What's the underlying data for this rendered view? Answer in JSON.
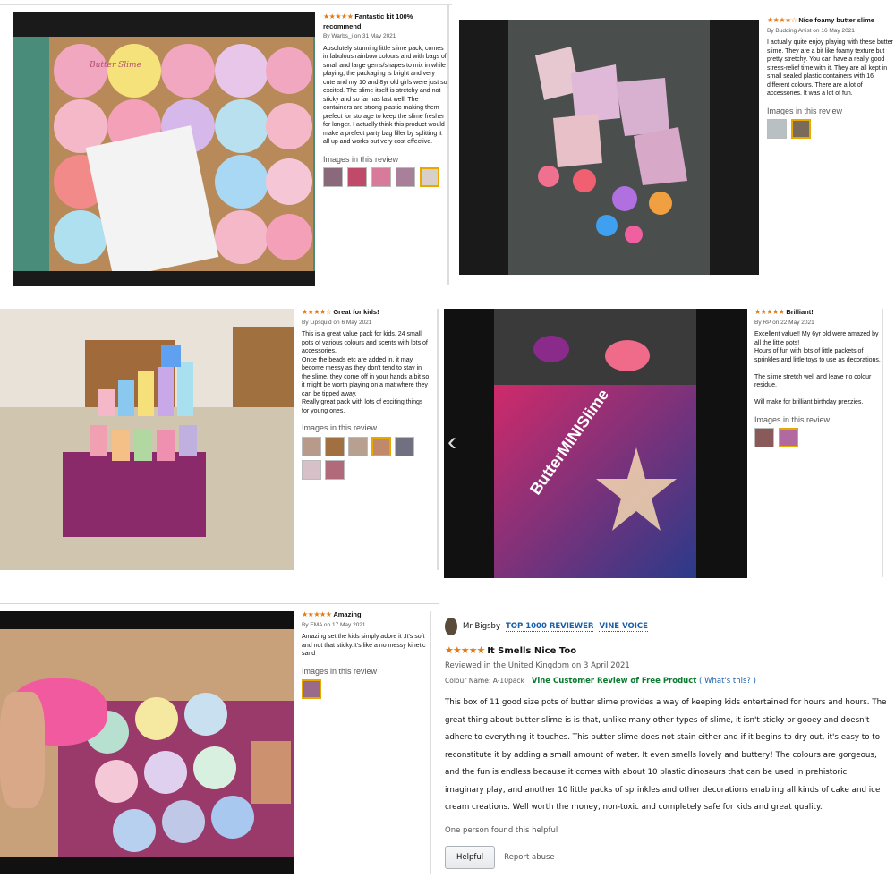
{
  "reviews": [
    {
      "stars": "★★★★★",
      "title": "Fantastic kit 100% recommend",
      "byline": "By Warbs_i on 31 May 2021",
      "body": "Absolutely stunning little slime pack, comes in fabulous rainbow colours and with bags of small and large gems/shapes to mix in while playing, the packaging is bright and very cute and my 10 and 8yr old girls were just so excited. The slime itself is stretchy and not sticky and so far has last well. The containers are strong plastic making them prefect for storage to keep the slime fresher for longer. I actually think this product would make a prefect party bag filler by splitting it all up and works out very cost effective.",
      "images_heading": "Images in this review"
    },
    {
      "stars": "★★★★☆",
      "title": "Nice foamy butter slime",
      "byline": "By Budding Artist on 16 May 2021",
      "body": "I actually quite enjoy playing with these butter slime. They are a bit like foamy texture but pretty stretchy. You can have a really good stress-relief time with it. They are all kept in small sealed plastic containers with 16 different colours. There are a lot of accessories. It was a lot of fun.",
      "images_heading": "Images in this review"
    },
    {
      "stars": "★★★★☆",
      "title": "Great for kids!",
      "byline": "By Lipsquid on 6 May 2021",
      "body": "This is a great value pack for kids. 24 small pots of various colours and scents with lots of accessories.\nOnce the beads etc are added in, it may become messy as they don't tend to stay in the slime, they come off in your hands a bit so it might be worth playing on a mat where they can be tipped away.\nReally great pack with lots of exciting things for young ones.",
      "images_heading": "Images in this review"
    },
    {
      "stars": "★★★★★",
      "title": "Brilliant!",
      "byline": "By RP on 22 May 2021",
      "body": "Excellent value!! My 6yr old were amazed by all the little pots!\nHours of fun with lots of little packets of sprinkles and little toys to use as decorations.\n\nThe slime stretch well and leave no colour residue.\n\nWill make for brilliant birthday prezzies.",
      "images_heading": "Images in this review"
    },
    {
      "stars": "★★★★★",
      "title": "Amazing",
      "byline": "By EMA on 17 May 2021",
      "body": "Amazing set,the kids simply adore it .It's soft and not that sticky.It's like a no messy kinetic sand",
      "images_heading": "Images in this review"
    }
  ],
  "photo_labels": {
    "box_brand": "ButterMINISlime",
    "pot_label": "Butter Slime"
  },
  "featured": {
    "reviewer": "Mr Bigsby",
    "badge1": "TOP 1000 REVIEWER",
    "badge2": "VINE VOICE",
    "stars": "★★★★★",
    "title": "It Smells Nice Too",
    "reviewed_in": "Reviewed in the United Kingdom on 3 April 2021",
    "colour": "Colour Name: A-10pack",
    "vine": "Vine Customer Review of Free Product",
    "whats_this": "( What's this? )",
    "text": "This box of 11 good size pots of butter slime provides a way of keeping kids entertained for hours and hours. The great thing about butter slime is is that, unlike many other types of slime, it isn't sticky or gooey and doesn't adhere to everything it touches. This butter slime does not stain either and if it begins to dry out, it's easy to to reconstitute it by adding a small amount of water. It even smells lovely and buttery! The colours are gorgeous, and the fun is endless because it comes with about 10 plastic dinosaurs that can be used in prehistoric imaginary play, and another 10 little packs of sprinkles and other decorations enabling all kinds of cake and ice cream creations. Well worth the money, non-toxic and completely safe for kids and great quality.",
    "found_helpful": "One person found this helpful",
    "helpful_button": "Helpful",
    "report": "Report abuse"
  },
  "colors": {
    "star": "#e47911",
    "link": "#1a5fa8",
    "vine": "#0a7a2e"
  }
}
